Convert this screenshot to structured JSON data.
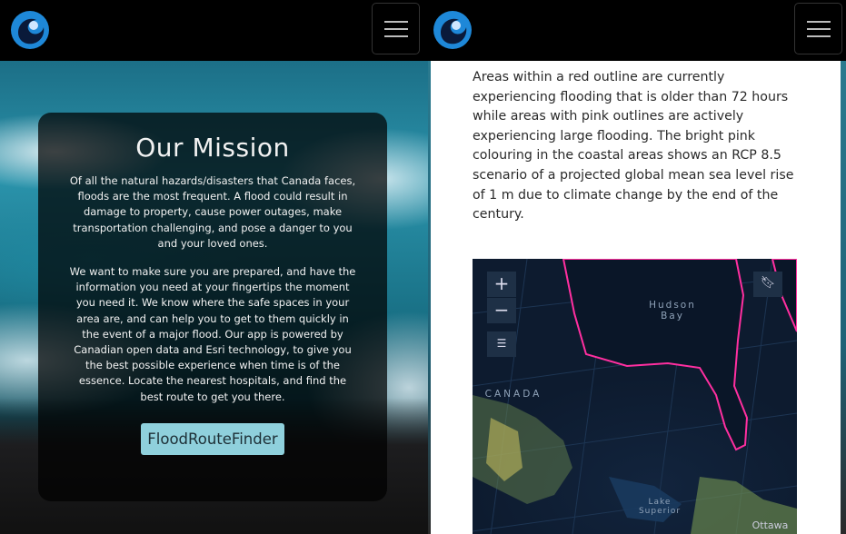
{
  "left_panel": {
    "mission": {
      "title": "Our Mission",
      "paragraph_1": "Of all the natural hazards/disasters that Canada faces, floods are the most frequent. A flood could result in damage to property, cause power outages, make transportation challenging, and pose a danger to you and your loved ones.",
      "paragraph_2": "We want to make sure you are prepared, and have the information you need at your fingertips the moment you need it. We know where the safe spaces in your area are, and can help you to get to them quickly in the event of a major flood. Our app is powered by Canadian open data and Esri technology, to give you the best possible experience when time is of the essence. Locate the nearest hospitals, and find the best route to get you there.",
      "button_label": "FloodRouteFinder"
    }
  },
  "right_panel": {
    "description": "Areas within a red outline are currently experiencing flooding that is older than 72 hours while areas with pink outlines are actively experiencing large flooding. The bright pink colouring in the coastal areas shows an RCP 8.5 scenario of a projected global mean sea level rise of 1 m due to climate change by the end of the century.",
    "map": {
      "zoom_in_symbol": "+",
      "zoom_out_symbol": "−",
      "labels": {
        "hudson_bay": "Hudson Bay",
        "canada": "CANADA",
        "lake_superior": "Lake Superior",
        "ottawa": "Ottawa"
      }
    }
  },
  "colors": {
    "navbar": "#000000",
    "logo_blue": "#1e88d8",
    "button_bg": "#8fd0dc",
    "flood_pink": "#ff2fa0",
    "map_bg": "#0d1b2f"
  }
}
